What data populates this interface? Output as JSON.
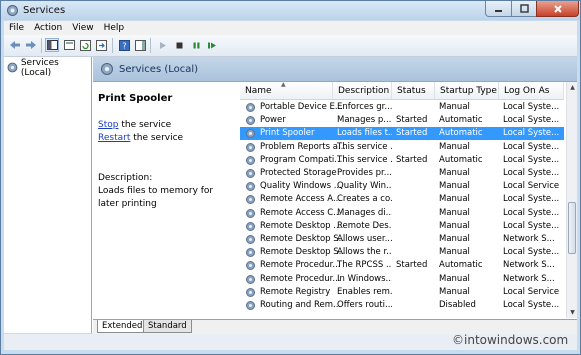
{
  "window": {
    "title": "Services"
  },
  "menu": [
    "File",
    "Action",
    "View",
    "Help"
  ],
  "tree": {
    "root": "Services (Local)"
  },
  "header": {
    "title": "Services (Local)"
  },
  "description_pane": {
    "service_name": "Print Spooler",
    "stop_link": "Stop",
    "stop_suffix": " the service",
    "restart_link": "Restart",
    "restart_suffix": " the service",
    "description_label": "Description:",
    "description_text": "Loads files to memory for later printing"
  },
  "columns": [
    "Name",
    "Description",
    "Status",
    "Startup Type",
    "Log On As"
  ],
  "rows": [
    {
      "name": "Portable Device E...",
      "description": "Enforces gr...",
      "status": "",
      "startup": "Manual",
      "logon": "Local Syste..."
    },
    {
      "name": "Power",
      "description": "Manages p...",
      "status": "Started",
      "startup": "Automatic",
      "logon": "Local Syste..."
    },
    {
      "name": "Print Spooler",
      "description": "Loads files t...",
      "status": "Started",
      "startup": "Automatic",
      "logon": "Local Syste...",
      "selected": true
    },
    {
      "name": "Problem Reports a...",
      "description": "This service ...",
      "status": "",
      "startup": "Manual",
      "logon": "Local Syste..."
    },
    {
      "name": "Program Compati...",
      "description": "This service ...",
      "status": "Started",
      "startup": "Automatic",
      "logon": "Local Syste..."
    },
    {
      "name": "Protected Storage",
      "description": "Provides pr...",
      "status": "",
      "startup": "Manual",
      "logon": "Local Syste..."
    },
    {
      "name": "Quality Windows ...",
      "description": "Quality Win...",
      "status": "",
      "startup": "Manual",
      "logon": "Local Service"
    },
    {
      "name": "Remote Access A...",
      "description": "Creates a co...",
      "status": "",
      "startup": "Manual",
      "logon": "Local Syste..."
    },
    {
      "name": "Remote Access C...",
      "description": "Manages di...",
      "status": "",
      "startup": "Manual",
      "logon": "Local Syste..."
    },
    {
      "name": "Remote Desktop ...",
      "description": "Remote Des...",
      "status": "",
      "startup": "Manual",
      "logon": "Local Syste..."
    },
    {
      "name": "Remote Desktop S...",
      "description": "Allows user...",
      "status": "",
      "startup": "Manual",
      "logon": "Network S..."
    },
    {
      "name": "Remote Desktop S...",
      "description": "Allows the r...",
      "status": "",
      "startup": "Manual",
      "logon": "Local Syste..."
    },
    {
      "name": "Remote Procedur...",
      "description": "The RPCSS ...",
      "status": "Started",
      "startup": "Automatic",
      "logon": "Network S..."
    },
    {
      "name": "Remote Procedur...",
      "description": "In Windows...",
      "status": "",
      "startup": "Manual",
      "logon": "Network S..."
    },
    {
      "name": "Remote Registry",
      "description": "Enables rem...",
      "status": "",
      "startup": "Manual",
      "logon": "Local Service"
    },
    {
      "name": "Routing and Rem...",
      "description": "Offers routi...",
      "status": "",
      "startup": "Disabled",
      "logon": "Local Syste..."
    }
  ],
  "tabs": [
    "Extended",
    "Standard"
  ],
  "watermark": "©intowindows.com",
  "colors": {
    "selection": "#3399ff",
    "link": "#1a3ebf",
    "header_bg": "#b7cbe1"
  }
}
